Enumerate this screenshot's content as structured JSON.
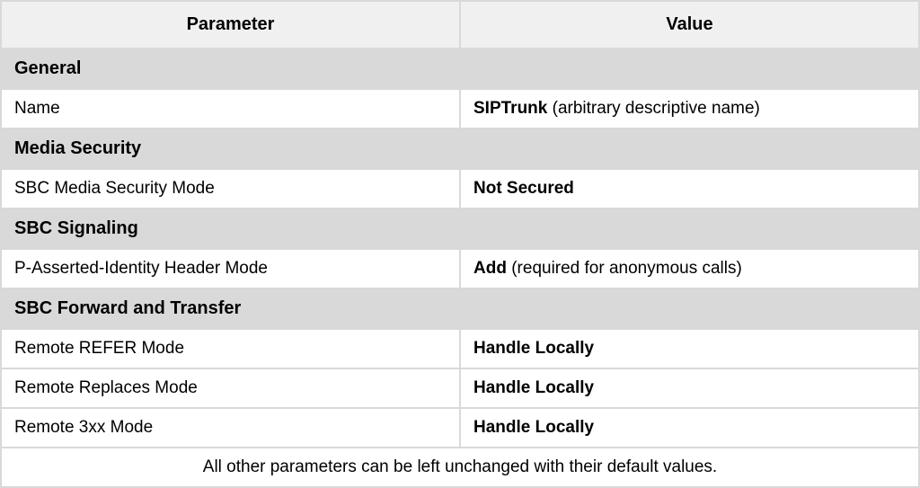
{
  "headers": {
    "parameter": "Parameter",
    "value": "Value"
  },
  "sections": [
    {
      "title": "General",
      "rows": [
        {
          "param": "Name",
          "value_bold": "SIPTrunk",
          "value_note": "  (arbitrary descriptive name)"
        }
      ]
    },
    {
      "title": "Media Security",
      "rows": [
        {
          "param": "SBC Media Security Mode",
          "value_bold": "Not Secured",
          "value_note": ""
        }
      ]
    },
    {
      "title": "SBC Signaling",
      "rows": [
        {
          "param": "P-Asserted-Identity Header Mode",
          "value_bold": "Add",
          "value_note": " (required for anonymous calls)"
        }
      ]
    },
    {
      "title": "SBC Forward and Transfer",
      "rows": [
        {
          "param": "Remote REFER Mode",
          "value_bold": "Handle Locally",
          "value_note": ""
        },
        {
          "param": "Remote Replaces Mode",
          "value_bold": "Handle Locally",
          "value_note": ""
        },
        {
          "param": "Remote 3xx Mode",
          "value_bold": "Handle Locally",
          "value_note": ""
        }
      ]
    }
  ],
  "footer": "All other parameters can be left unchanged with their default values."
}
